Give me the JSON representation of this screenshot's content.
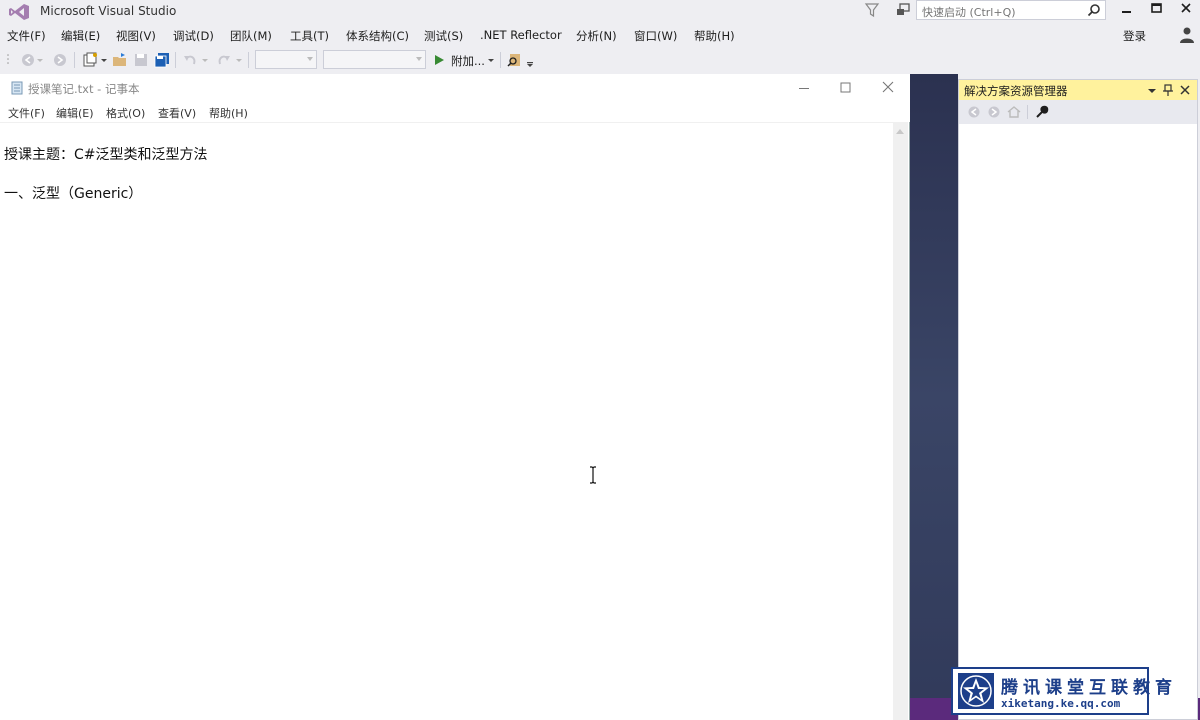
{
  "vs": {
    "title": "Microsoft Visual Studio",
    "quick_launch_placeholder": "快速启动 (Ctrl+Q)",
    "menu": [
      "文件(F)",
      "编辑(E)",
      "视图(V)",
      "调试(D)",
      "团队(M)",
      "工具(T)",
      "体系结构(C)",
      "测试(S)",
      ".NET Reflector",
      "分析(N)",
      "窗口(W)",
      "帮助(H)"
    ],
    "sign_in": "登录",
    "toolbar": {
      "attach_label": "附加..."
    }
  },
  "notepad": {
    "title": "授课笔记.txt - 记事本",
    "menu": [
      "文件(F)",
      "编辑(E)",
      "格式(O)",
      "查看(V)",
      "帮助(H)"
    ],
    "lines": [
      "授课主题：C#泛型类和泛型方法",
      "一、泛型（Generic）"
    ]
  },
  "solution_explorer": {
    "title": "解决方案资源管理器"
  },
  "watermark": {
    "name": "腾讯课堂互联教育",
    "url": "xiketang.ke.qq.com"
  },
  "colors": {
    "vs_chrome": "#eeeef2",
    "panel_header": "#fff29d",
    "vs_dark_bg": "#2b3150",
    "accent_purple": "#5b2a7c",
    "watermark_blue": "#1d3f8a"
  }
}
